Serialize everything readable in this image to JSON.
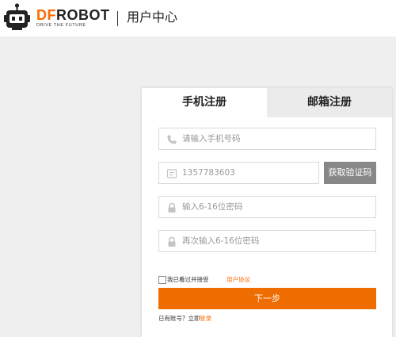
{
  "header": {
    "brand_prefix": "DF",
    "brand_suffix": "ROBOT",
    "tagline": "DRIVE THE FUTURE",
    "title": "用户中心"
  },
  "tabs": [
    {
      "label": "手机注册",
      "active": true
    },
    {
      "label": "邮箱注册",
      "active": false
    }
  ],
  "form": {
    "phone_placeholder": "请输入手机号码",
    "code_value": "1357783603",
    "code_button": "获取验证码",
    "password_placeholder": "输入6-16位密码",
    "confirm_placeholder": "再次输入6-16位密码",
    "agree_text": "我已看过并接受",
    "agree_link": "用户协议",
    "next_button": "下一步",
    "login_prompt": "已有账号？立即",
    "login_link": "登录"
  },
  "colors": {
    "accent": "#ef6c00",
    "link": "#ff6a00",
    "code_button_bg": "#888888",
    "inactive_tab_bg": "#ebebeb"
  },
  "icons": [
    "robot-logo-icon",
    "phone-icon",
    "captcha-icon",
    "lock-icon"
  ]
}
